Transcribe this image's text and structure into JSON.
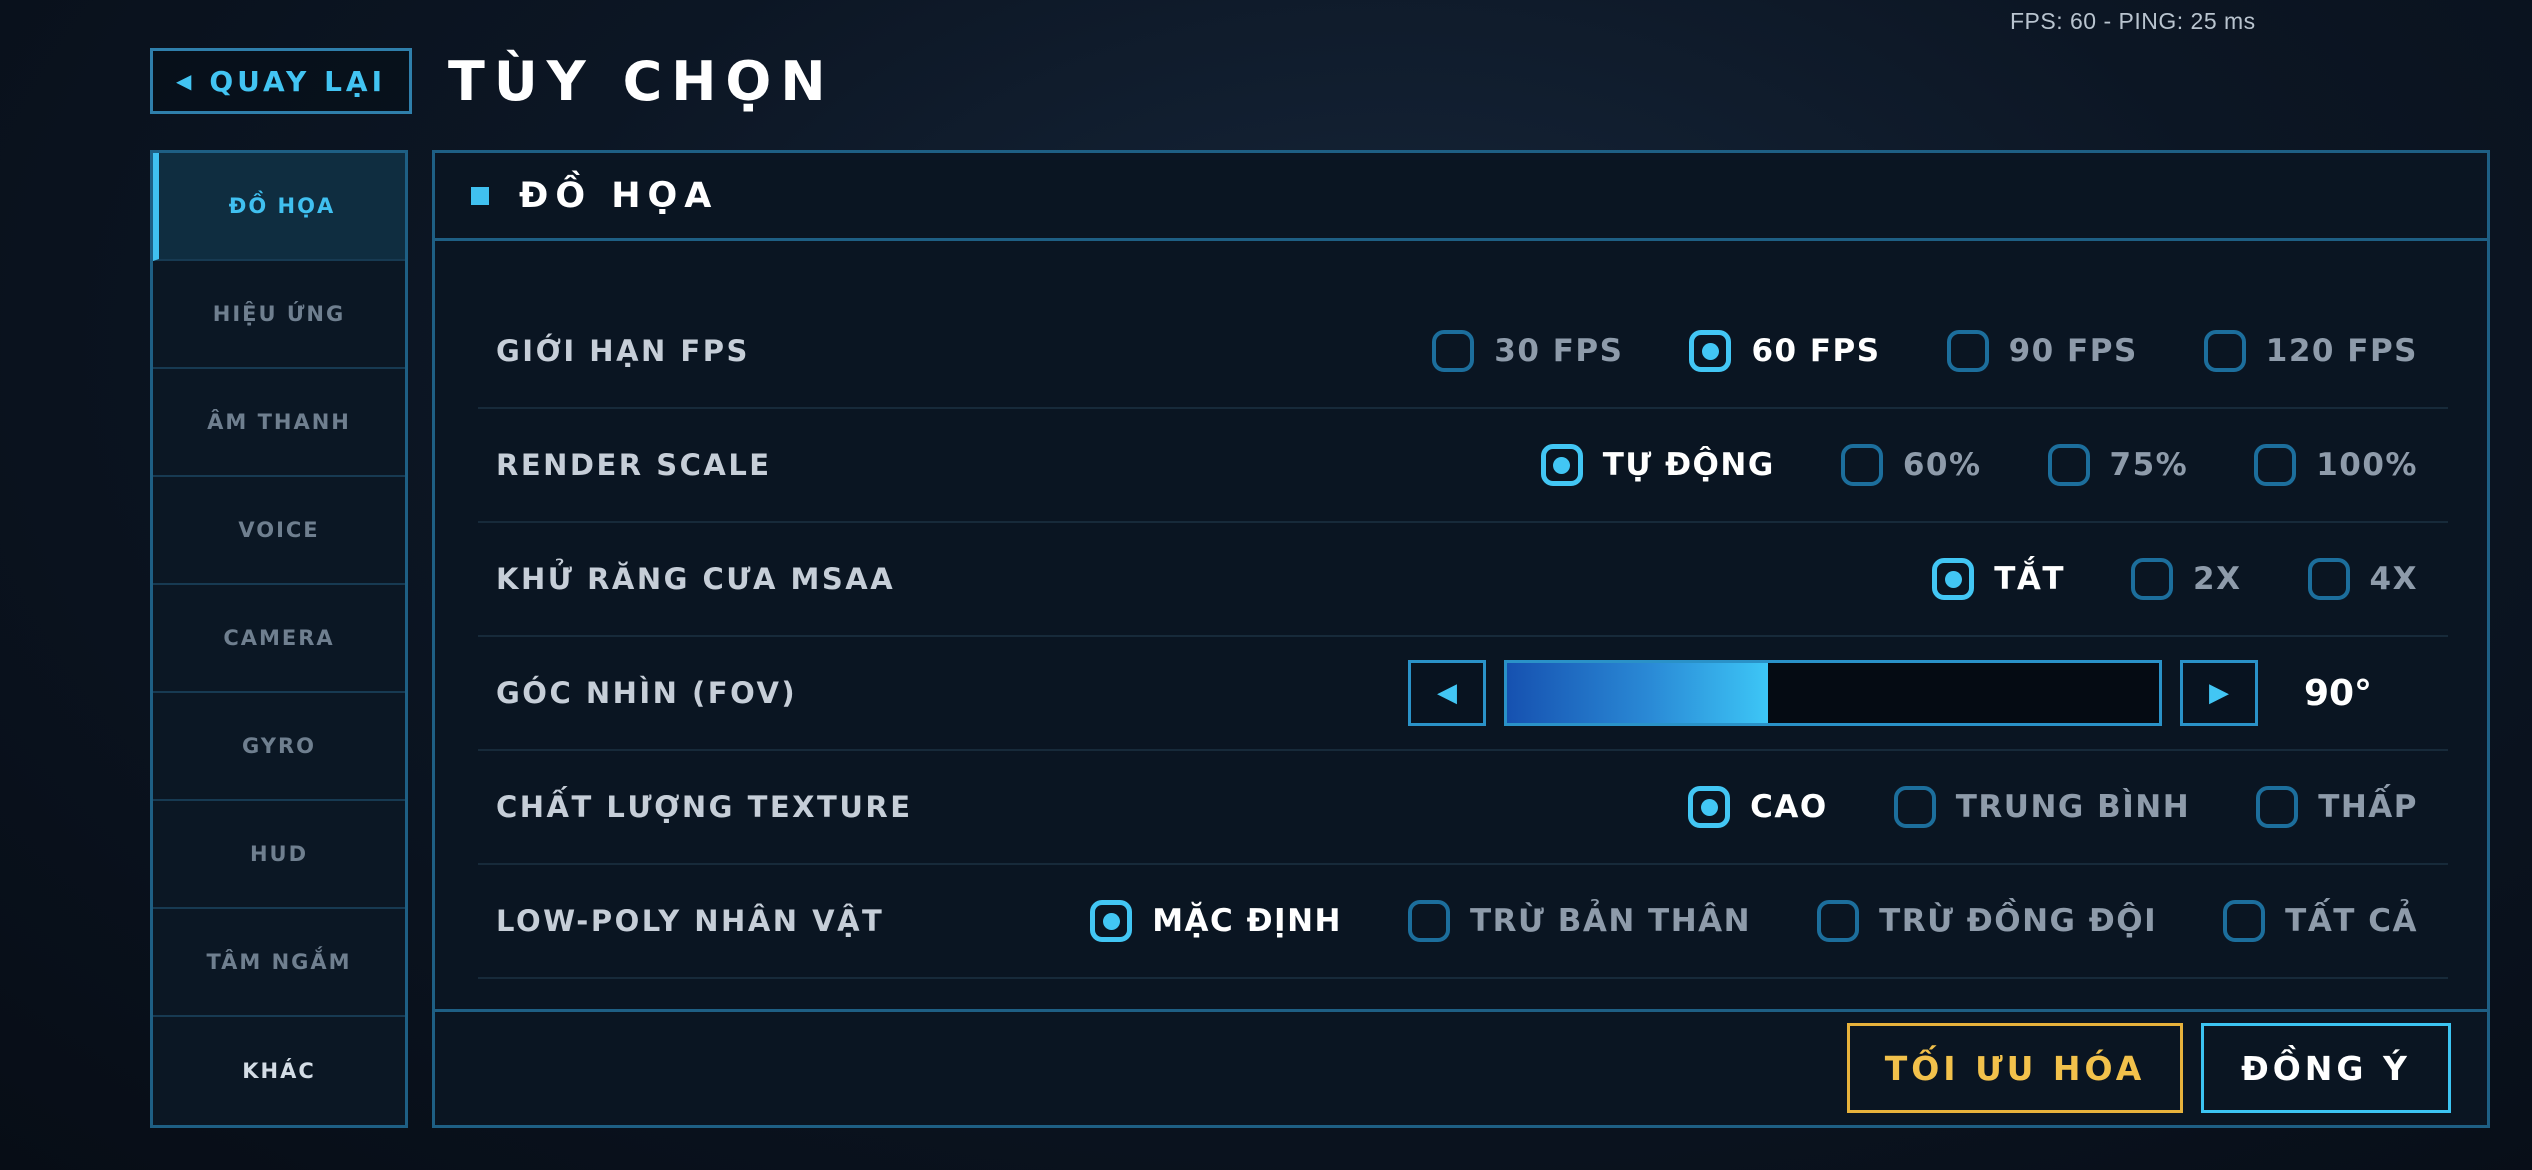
{
  "status": {
    "fps_ping": "FPS: 60 - PING: 25 ms"
  },
  "header": {
    "back_label": "QUAY LẠI",
    "title": "TÙY CHỌN"
  },
  "sidebar": {
    "items": [
      {
        "label": "ĐỒ HỌA",
        "active": true
      },
      {
        "label": "HIỆU ỨNG"
      },
      {
        "label": "ÂM THANH"
      },
      {
        "label": "VOICE"
      },
      {
        "label": "CAMERA"
      },
      {
        "label": "GYRO"
      },
      {
        "label": "HUD"
      },
      {
        "label": "TÂM NGẮM"
      },
      {
        "label": "KHÁC"
      }
    ]
  },
  "panel": {
    "title": "ĐỒ HỌA",
    "rows": [
      {
        "label": "GIỚI HẠN FPS",
        "options": [
          "30 FPS",
          "60 FPS",
          "90 FPS",
          "120 FPS"
        ],
        "selected": 1
      },
      {
        "label": "RENDER SCALE",
        "options": [
          "TỰ ĐỘNG",
          "60%",
          "75%",
          "100%"
        ],
        "selected": 0
      },
      {
        "label": "KHỬ RĂNG CƯA MSAA",
        "options": [
          "TẮT",
          "2X",
          "4X"
        ],
        "selected": 0
      },
      {
        "label": "GÓC NHÌN (FOV)",
        "slider": {
          "value_text": "90°",
          "fill_fraction": 0.4
        }
      },
      {
        "label": "CHẤT LƯỢNG TEXTURE",
        "options": [
          "CAO",
          "TRUNG BÌNH",
          "THẤP"
        ],
        "selected": 0
      },
      {
        "label": "LOW-POLY NHÂN VẬT",
        "options": [
          "MẶC ĐỊNH",
          "TRỪ BẢN THÂN",
          "TRỪ ĐỒNG ĐỘI",
          "TẤT CẢ"
        ],
        "selected": 0
      }
    ]
  },
  "footer": {
    "optimize_label": "TỐI ƯU HÓA",
    "agree_label": "ĐỒNG Ý"
  },
  "colors": {
    "accent": "#42c6f4",
    "gold": "#f2c14b",
    "panel_border": "#1e5f84",
    "background": "#0a1522"
  },
  "icons": {
    "back": "triangle-left-icon",
    "slider_prev": "triangle-left-icon",
    "slider_next": "triangle-right-icon"
  }
}
